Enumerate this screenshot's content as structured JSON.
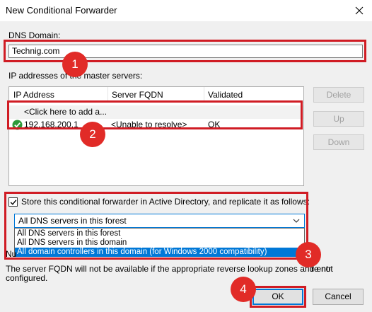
{
  "window": {
    "title": "New Conditional Forwarder",
    "close_icon": "close-icon"
  },
  "dns_domain": {
    "label": "DNS Domain:",
    "value": "Technig.com"
  },
  "ip_section": {
    "label": "IP addresses of the master servers:"
  },
  "table": {
    "columns": [
      "IP Address",
      "Server FQDN",
      "Validated"
    ],
    "add_row": "<Click here to add a...",
    "rows": [
      {
        "ip": "192.168.200.1",
        "fqdn": "<Unable to resolve>",
        "validated": "OK",
        "status_icon": "check-circle-icon"
      }
    ]
  },
  "side_buttons": {
    "delete": "Delete",
    "up": "Up",
    "down": "Down"
  },
  "replicate": {
    "checked": true,
    "label": "Store this conditional forwarder in Active Directory, and replicate it as follows:",
    "selected": "All DNS servers in this forest",
    "options": [
      "All DNS servers in this forest",
      "All DNS servers in this domain",
      "All domain controllers in this domain (for Windows 2000 compatibility)"
    ]
  },
  "note": {
    "prefix": "Nu",
    "line1": "The server FQDN will not be available if the appropriate reverse lookup zones and entr",
    "line1_tail": "re not",
    "line2": "configured."
  },
  "buttons": {
    "ok": "OK",
    "cancel": "Cancel"
  },
  "annotations": [
    "1",
    "2",
    "3",
    "4"
  ],
  "colors": {
    "annotation": "#d01c24",
    "selection": "#0078d7",
    "valid": "#2e9a3a"
  }
}
